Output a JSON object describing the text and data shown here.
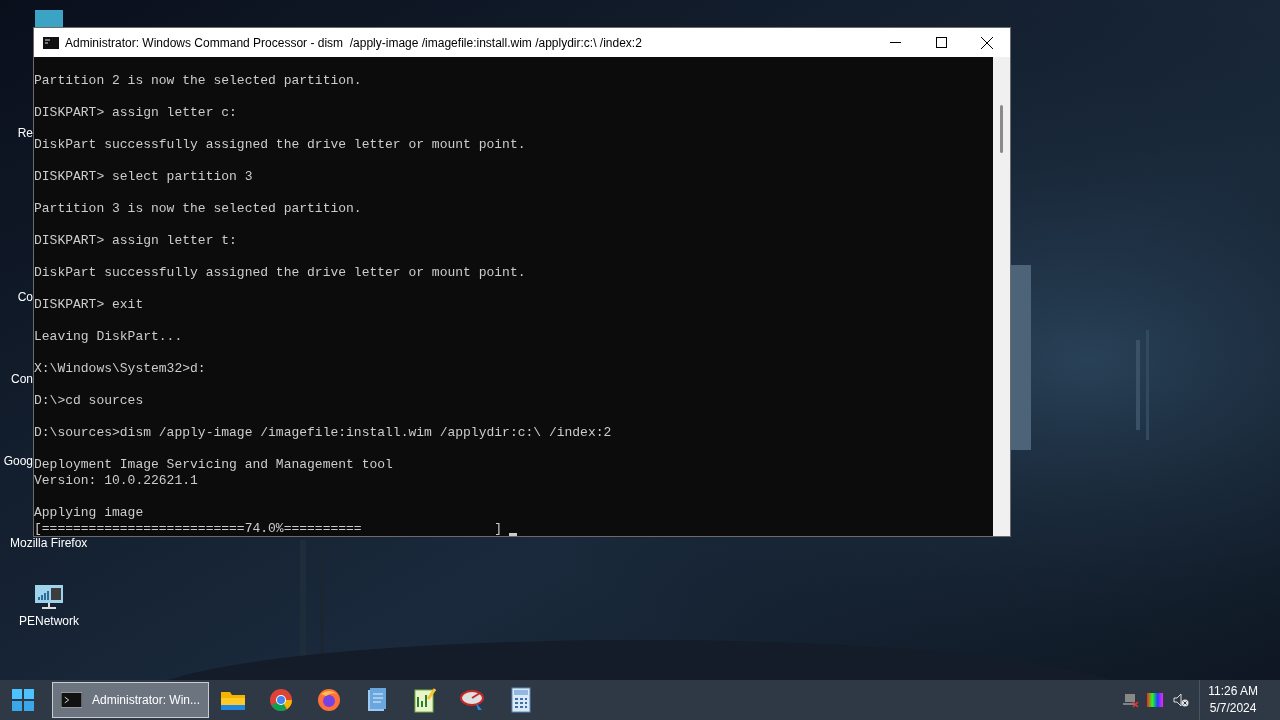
{
  "desktop_icons": [
    {
      "label": "Re",
      "kind": "fragment"
    },
    {
      "label": "Co",
      "kind": "fragment"
    },
    {
      "label": "Con",
      "kind": "fragment"
    },
    {
      "label": "Goog",
      "kind": "fragment"
    },
    {
      "label": "Mozilla Firefox",
      "kind": "fragment"
    },
    {
      "label": "PENetwork",
      "kind": "network"
    }
  ],
  "window": {
    "title": "Administrator: Windows Command Processor - dism  /apply-image /imagefile:install.wim /applydir:c:\\ /index:2",
    "console_blocks": [
      [
        "Partition 2 is now the selected partition."
      ],
      [
        "DISKPART> assign letter c:"
      ],
      [
        "DiskPart successfully assigned the drive letter or mount point."
      ],
      [
        "DISKPART> select partition 3"
      ],
      [
        "Partition 3 is now the selected partition."
      ],
      [
        "DISKPART> assign letter t:"
      ],
      [
        "DiskPart successfully assigned the drive letter or mount point."
      ],
      [
        "DISKPART> exit"
      ],
      [
        "Leaving DiskPart..."
      ],
      [
        "X:\\Windows\\System32>d:"
      ],
      [
        "D:\\>cd sources"
      ],
      [
        "D:\\sources>dism /apply-image /imagefile:install.wim /applydir:c:\\ /index:2"
      ],
      [
        "Deployment Image Servicing and Management tool",
        "Version: 10.0.22621.1"
      ],
      [
        "Applying image",
        "[==========================74.0%==========                 ]"
      ]
    ]
  },
  "taskbar": {
    "apps": [
      {
        "label": "Administrator: Win...",
        "kind": "terminal",
        "selected": true
      },
      {
        "kind": "folder",
        "selected": false
      },
      {
        "kind": "chrome",
        "selected": false
      },
      {
        "kind": "firefox",
        "selected": false
      },
      {
        "kind": "notepad",
        "selected": false
      },
      {
        "kind": "chart",
        "selected": false
      },
      {
        "kind": "disk",
        "selected": false
      },
      {
        "kind": "calculator",
        "selected": false
      }
    ],
    "clock": {
      "time": "11:26 AM",
      "date": "5/7/2024"
    }
  }
}
